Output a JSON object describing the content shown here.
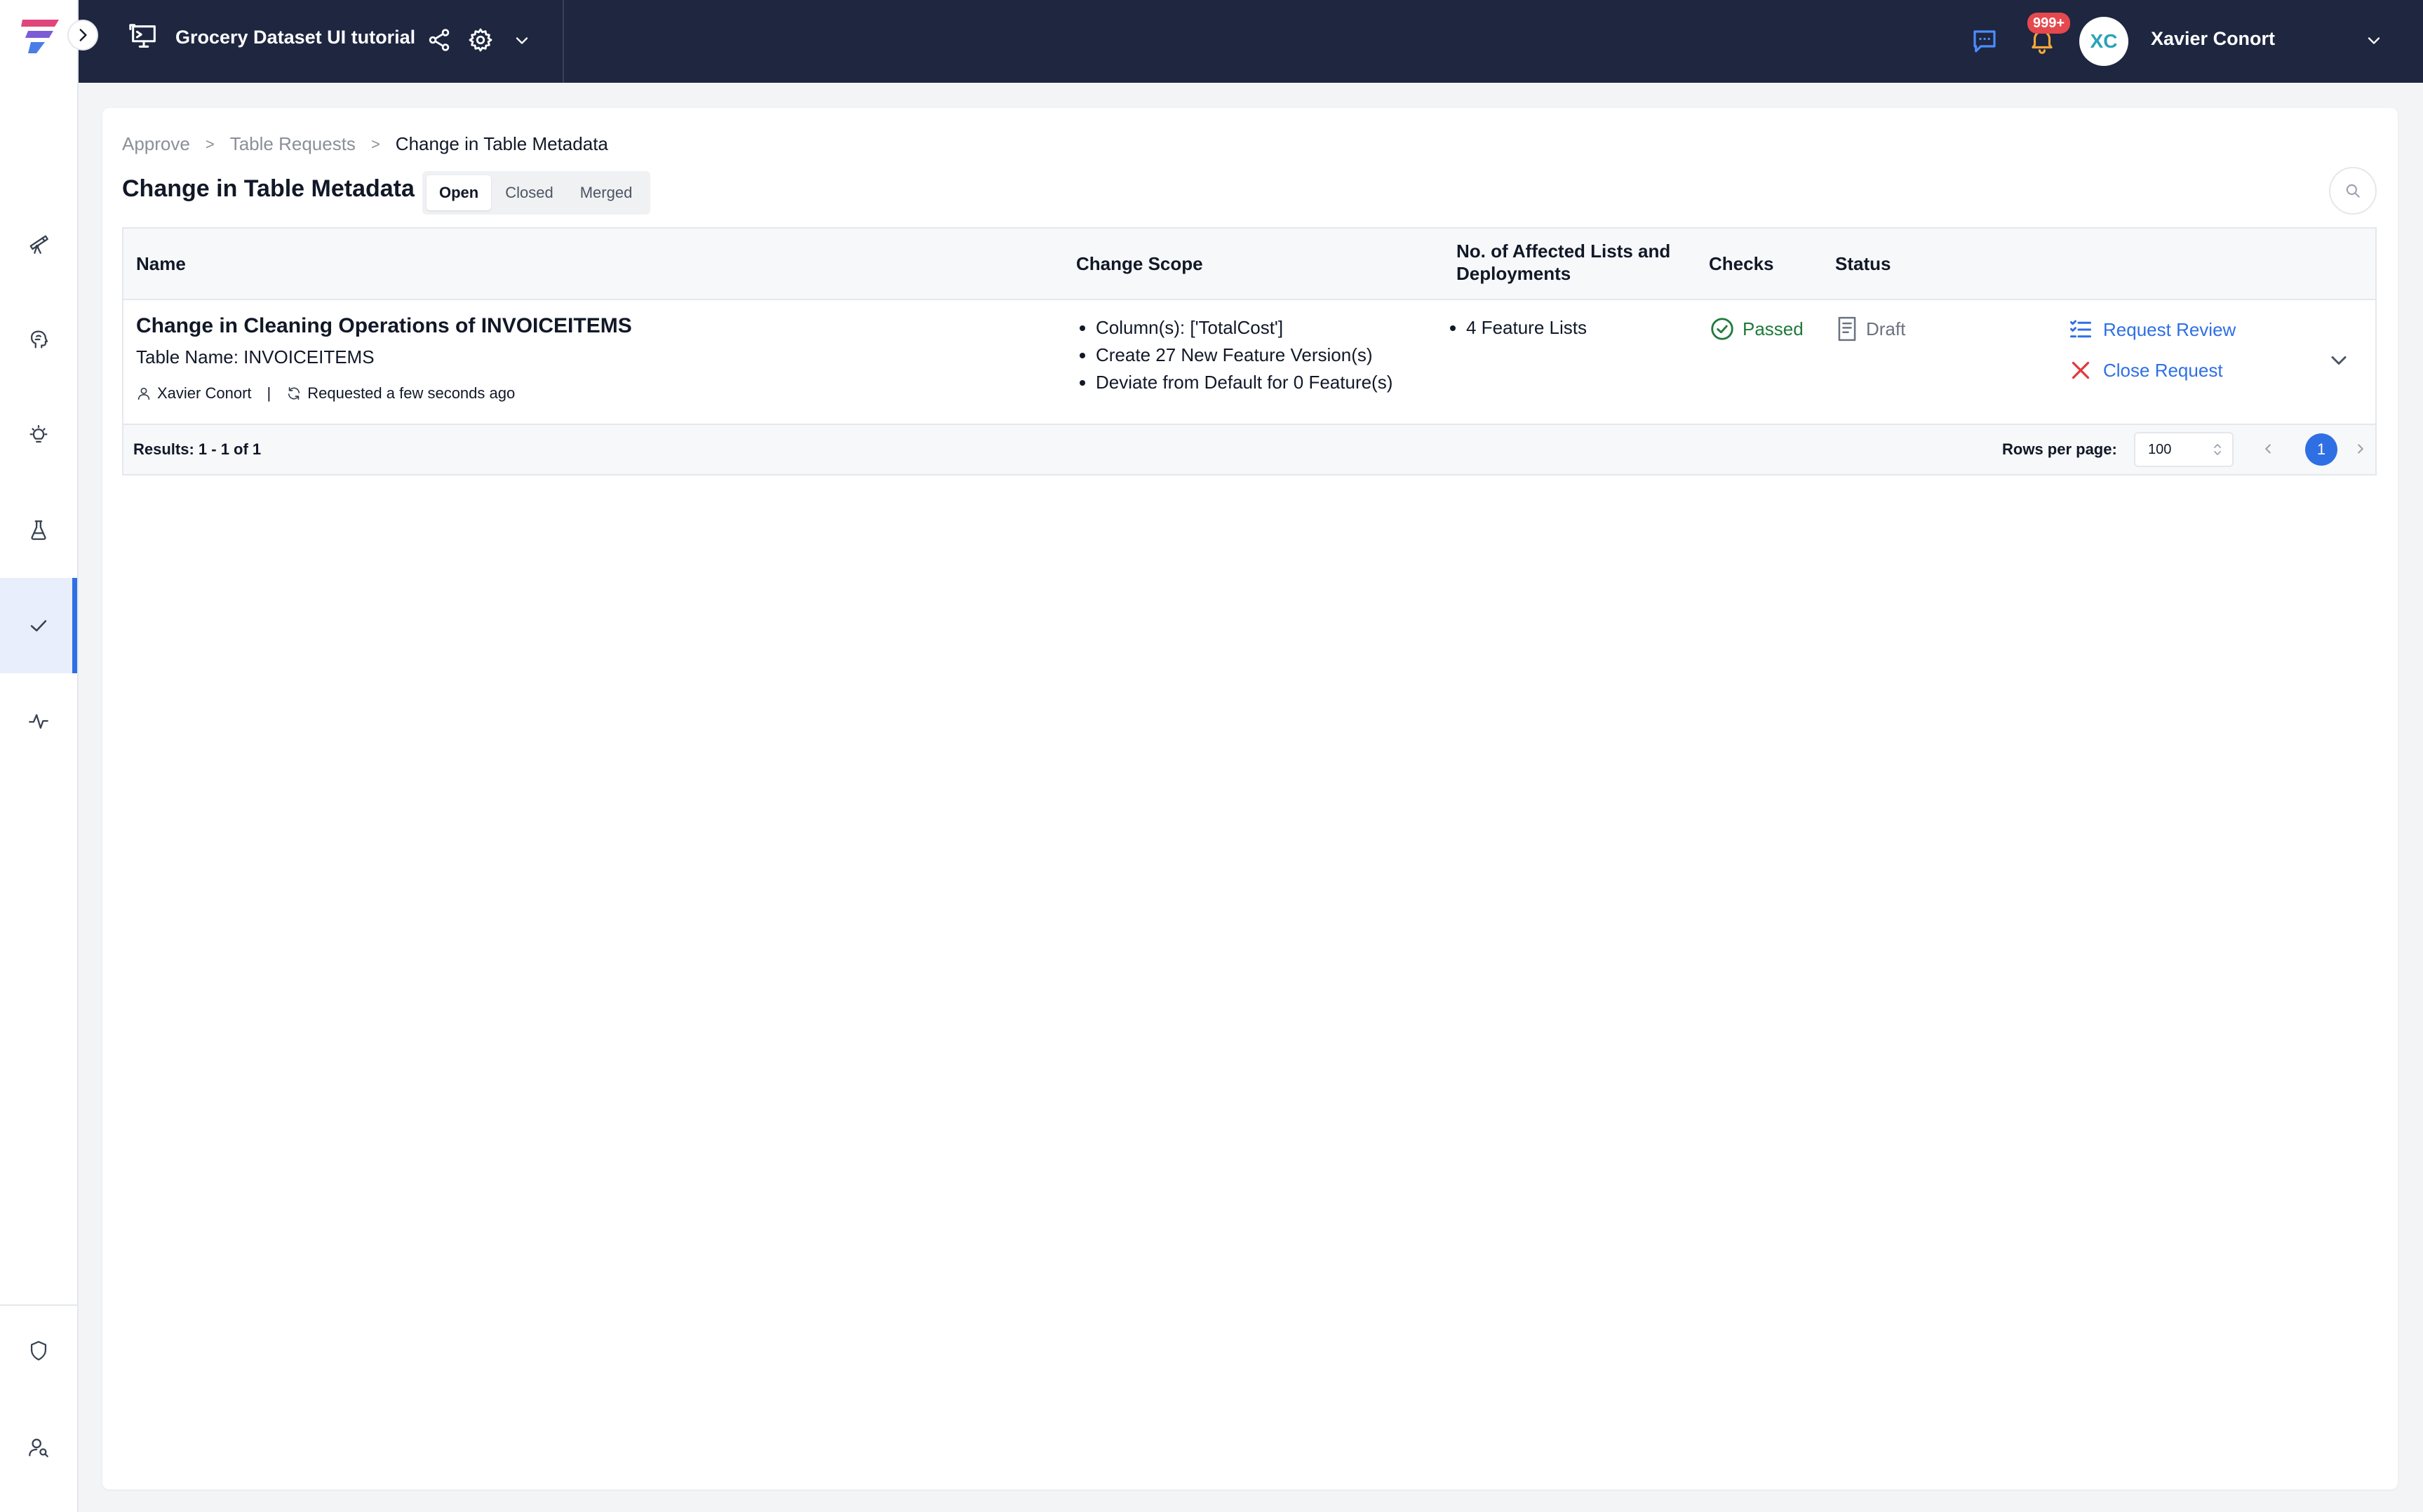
{
  "app": {
    "project_title": "Grocery Dataset UI tutorial",
    "notification_count": "999+",
    "user_initials": "XC",
    "user_name": "Xavier Conort",
    "colors": {
      "topbar": "#1e2640",
      "accent": "#2f6fe4",
      "passed": "#1f7a3a",
      "close": "#e03a3a"
    }
  },
  "sidebar": {
    "items": [
      {
        "icon": "telescope-icon",
        "active": false
      },
      {
        "icon": "brain-icon",
        "active": false
      },
      {
        "icon": "lightbulb-icon",
        "active": false
      },
      {
        "icon": "flask-icon",
        "active": false
      },
      {
        "icon": "check-icon",
        "active": true
      },
      {
        "icon": "activity-icon",
        "active": false
      }
    ],
    "bottom_items": [
      {
        "icon": "shield-icon"
      },
      {
        "icon": "user-search-icon"
      }
    ]
  },
  "breadcrumb": {
    "items": [
      "Approve",
      "Table Requests",
      "Change in Table Metadata"
    ],
    "separator": ">"
  },
  "page": {
    "title": "Change in Table Metadata",
    "tabs": [
      {
        "label": "Open",
        "active": true
      },
      {
        "label": "Closed",
        "active": false
      },
      {
        "label": "Merged",
        "active": false
      }
    ]
  },
  "table": {
    "columns": [
      "Name",
      "Change Scope",
      "No. of Affected Lists and Deployments",
      "Checks",
      "Status"
    ],
    "rows": [
      {
        "title": "Change in Cleaning Operations of INVOICEITEMS",
        "table_name": "Table Name: INVOICEITEMS",
        "author": "Xavier Conort",
        "requested": "Requested a few seconds ago",
        "change_scope": [
          "Column(s): ['TotalCost']",
          "Create 27 New Feature Version(s)",
          "Deviate from Default for 0 Feature(s)"
        ],
        "affected": [
          "4 Feature Lists"
        ],
        "checks": "Passed",
        "status": "Draft",
        "actions": [
          "Request Review",
          "Close Request"
        ]
      }
    ],
    "footer": {
      "results": "Results: 1 - 1 of 1",
      "rows_per_page_label": "Rows per page:",
      "rows_per_page_value": "100",
      "current_page": "1"
    }
  }
}
